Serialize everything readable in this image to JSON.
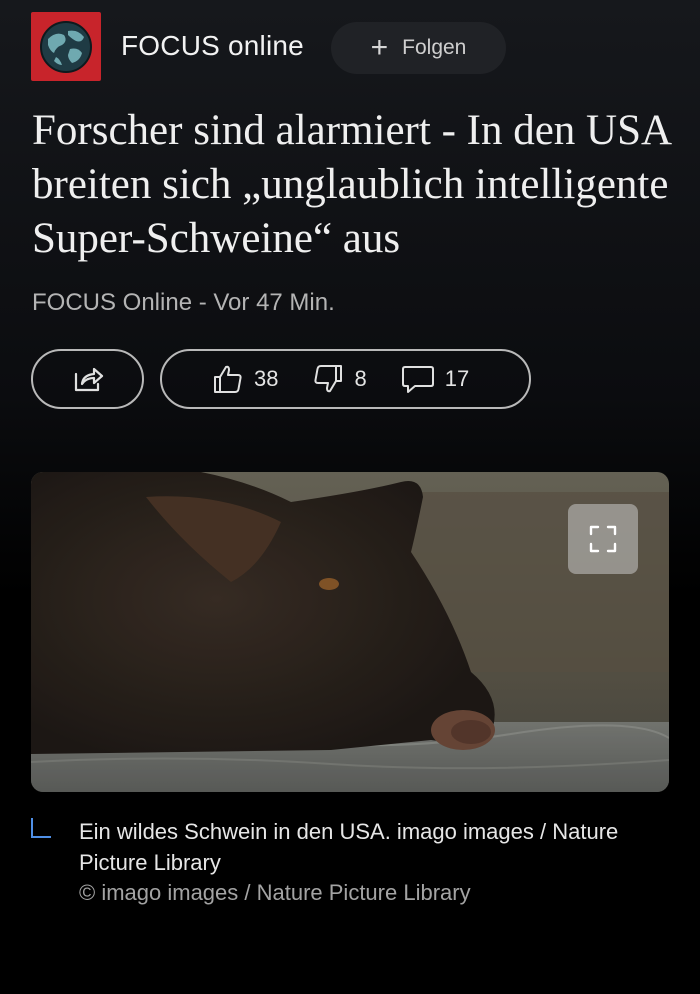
{
  "source": {
    "name": "FOCUS online",
    "logo_icon": "globe-icon",
    "brand_color": "#c8242b"
  },
  "follow_button": {
    "label": "Folgen",
    "icon": "plus-icon"
  },
  "article": {
    "headline": "Forscher sind alarmiert - In den USA breiten sich „unglaublich intelligente Super-Schweine“ aus",
    "byline": "FOCUS Online - Vor 47 Min."
  },
  "actions": {
    "share_icon": "share-icon",
    "likes": "38",
    "dislikes": "8",
    "comments": "17"
  },
  "image": {
    "fullscreen_icon": "expand-icon"
  },
  "caption": {
    "text": "Ein wildes Schwein in den USA. imago images / Nature Picture Library",
    "credit": "© imago images / Nature Picture Library",
    "accent_color": "#4f8fe6"
  }
}
